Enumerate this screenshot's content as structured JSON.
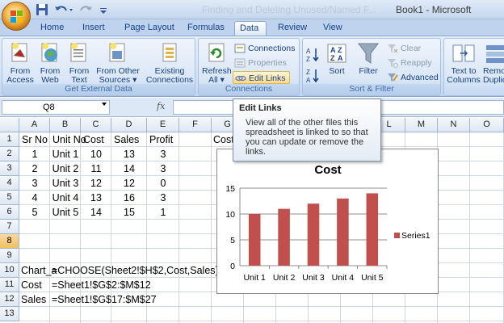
{
  "window": {
    "title": "Book1 - Microsoft",
    "faded_title": "Finding and Deleting Unused/Named F..."
  },
  "tabs": [
    {
      "label": "Home"
    },
    {
      "label": "Insert"
    },
    {
      "label": "Page Layout"
    },
    {
      "label": "Formulas"
    },
    {
      "label": "Data"
    },
    {
      "label": "Review"
    },
    {
      "label": "View"
    }
  ],
  "ribbon": {
    "groups": {
      "external": "Get External Data",
      "connections": "Connections",
      "sortfilter": "Sort & Filter"
    },
    "buttons": {
      "from_access": [
        "From",
        "Access"
      ],
      "from_web": [
        "From",
        "Web"
      ],
      "from_text": [
        "From",
        "Text"
      ],
      "from_other": [
        "From Other",
        "Sources ▾"
      ],
      "existing": [
        "Existing",
        "Connections"
      ],
      "refresh": [
        "Refresh",
        "All ▾"
      ],
      "connections": "Connections",
      "properties": "Properties",
      "edit_links": "Edit Links",
      "sort": "Sort",
      "filter": "Filter",
      "clear": "Clear",
      "reapply": "Reapply",
      "advanced": "Advanced",
      "text_to_columns": [
        "Text to",
        "Columns"
      ],
      "remove_dup": [
        "Remo",
        "Duplic"
      ]
    }
  },
  "formula_bar": {
    "name_box": "Q8",
    "fx": "fx",
    "formula": ""
  },
  "grid": {
    "columns": [
      "A",
      "B",
      "C",
      "D",
      "E",
      "F",
      "G",
      "H",
      "I",
      "J",
      "K",
      "L",
      "M",
      "N",
      "O"
    ],
    "rows": [
      "1",
      "2",
      "3",
      "4",
      "5",
      "6",
      "7",
      "8",
      "9",
      "10",
      "11",
      "12",
      "13"
    ],
    "selected_row": "8",
    "headers": [
      "Sr No",
      "Unit No",
      "Cost",
      "Sales",
      "Profit"
    ],
    "data": [
      [
        "1",
        "Unit 1",
        "10",
        "13",
        "3"
      ],
      [
        "2",
        "Unit 2",
        "11",
        "14",
        "3"
      ],
      [
        "3",
        "Unit 3",
        "12",
        "12",
        "0"
      ],
      [
        "4",
        "Unit 4",
        "13",
        "16",
        "3"
      ],
      [
        "5",
        "Unit 5",
        "14",
        "15",
        "1"
      ]
    ],
    "g1": "Cost",
    "row10_label": "Chart_a",
    "row10_formula": "=CHOOSE(Sheet2!$H$2,Cost,Sales)",
    "row11_label": "Cost",
    "row11_formula": "=Sheet1!$G$2:$M$12",
    "row12_label": "Sales",
    "row12_formula": "=Sheet1!$G$17:$M$27"
  },
  "tooltip": {
    "title": "Edit Links",
    "body": [
      "View all of the other files this",
      "spreadsheet is linked to so that",
      "you can update or remove the",
      "links."
    ]
  },
  "chart_data": {
    "type": "bar",
    "title": "Cost",
    "categories": [
      "Unit 1",
      "Unit 2",
      "Unit 3",
      "Unit 4",
      "Unit 5"
    ],
    "series": [
      {
        "name": "Series1",
        "values": [
          10,
          11,
          12,
          13,
          14
        ],
        "color": "#c0504d"
      }
    ],
    "ylim": [
      0,
      15
    ],
    "yticks": [
      0,
      5,
      10,
      15
    ],
    "grid": true,
    "legend": "right"
  }
}
